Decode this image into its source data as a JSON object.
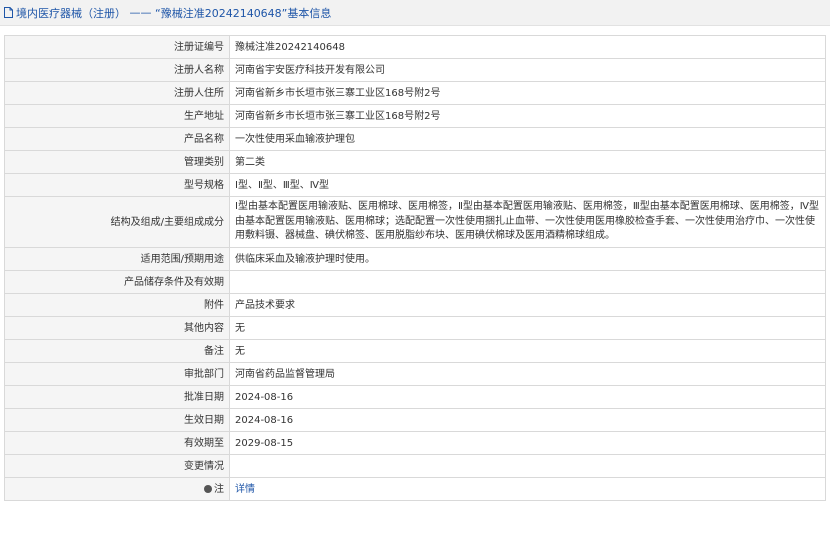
{
  "header": {
    "section": "境内医疗器械（注册）",
    "separator": " —— ",
    "record_title": "“豫械注准20242140648”基本信息"
  },
  "icons": {
    "header": "document-icon",
    "note": "note-icon"
  },
  "colors": {
    "link": "#1f56a8",
    "label_bg": "#f5f5f5",
    "border": "#d9d9d9"
  },
  "rows": [
    {
      "label": "注册证编号",
      "value": "豫械注准20242140648"
    },
    {
      "label": "注册人名称",
      "value": "河南省宇安医疗科技开发有限公司"
    },
    {
      "label": "注册人住所",
      "value": "河南省新乡市长垣市张三寨工业区168号附2号"
    },
    {
      "label": "生产地址",
      "value": "河南省新乡市长垣市张三寨工业区168号附2号"
    },
    {
      "label": "产品名称",
      "value": "一次性使用采血输液护理包"
    },
    {
      "label": "管理类别",
      "value": "第二类"
    },
    {
      "label": "型号规格",
      "value": "Ⅰ型、Ⅱ型、Ⅲ型、Ⅳ型"
    },
    {
      "label": "结构及组成/主要组成成分",
      "value": "Ⅰ型由基本配置医用输液贴、医用棉球、医用棉签，Ⅱ型由基本配置医用输液贴、医用棉签，Ⅲ型由基本配置医用棉球、医用棉签，Ⅳ型由基本配置医用输液贴、医用棉球；选配配置一次性使用捆扎止血带、一次性使用医用橡胶检查手套、一次性使用治疗巾、一次性使用敷料镊、器械盘、碘伏棉签、医用脱脂纱布块、医用碘伏棉球及医用酒精棉球组成。"
    },
    {
      "label": "适用范围/预期用途",
      "value": "供临床采血及输液护理时使用。"
    },
    {
      "label": "产品储存条件及有效期",
      "value": ""
    },
    {
      "label": "附件",
      "value": "产品技术要求"
    },
    {
      "label": "其他内容",
      "value": "无"
    },
    {
      "label": "备注",
      "value": "无"
    },
    {
      "label": "审批部门",
      "value": "河南省药品监督管理局"
    },
    {
      "label": "批准日期",
      "value": "2024-08-16"
    },
    {
      "label": "生效日期",
      "value": "2024-08-16"
    },
    {
      "label": "有效期至",
      "value": "2029-08-15"
    },
    {
      "label": "变更情况",
      "value": ""
    }
  ],
  "note_row": {
    "label": "注",
    "link": "详情"
  }
}
